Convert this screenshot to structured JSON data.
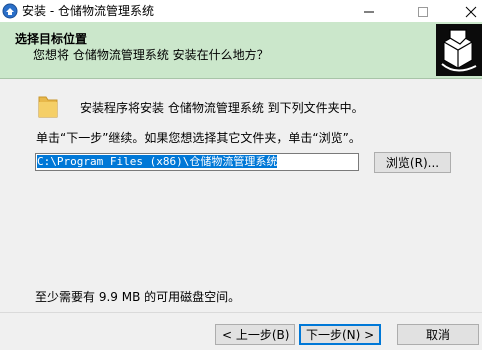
{
  "window": {
    "title": "安装 - 仓储物流管理系统"
  },
  "header": {
    "title": "选择目标位置",
    "subtitle": "您想将 仓储物流管理系统 安装在什么地方？"
  },
  "main": {
    "info_text": "安装程序将安装 仓储物流管理系统 到下列文件夹中。",
    "instruction": "单击“下一步”继续。如果您想选择其它文件夹，单击“浏览”。",
    "path_value": "C:\\Program Files (x86)\\仓储物流管理系统",
    "browse_label": "浏览(R)...",
    "space_required": "至少需要有 9.9 MB 的可用磁盘空间。"
  },
  "footer": {
    "back_label": "< 上一步(B)",
    "next_label": "下一步(N) >",
    "cancel_label": "取消"
  },
  "icons": {
    "app": "installer-app-icon",
    "header_logo": "installer-box-icon",
    "folder": "folder-icon"
  },
  "colors": {
    "header_bg": "#cbe7cb",
    "selection": "#0078d7",
    "window_bg": "#f0f0f0"
  }
}
